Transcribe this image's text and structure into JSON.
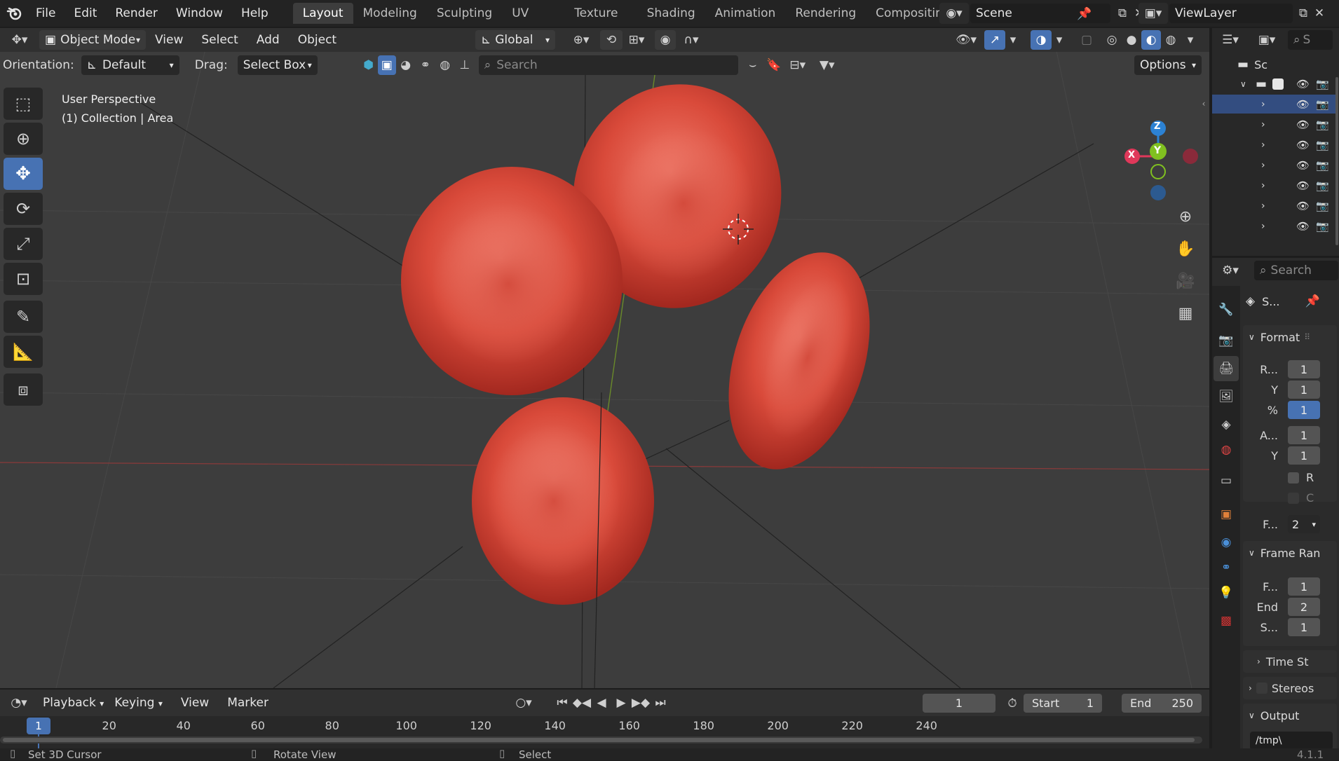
{
  "app": {
    "version": "4.1.1"
  },
  "menu": [
    "File",
    "Edit",
    "Render",
    "Window",
    "Help"
  ],
  "workspaces": [
    "Layout",
    "Modeling",
    "Sculpting",
    "UV Editing",
    "Texture Paint",
    "Shading",
    "Animation",
    "Rendering",
    "Compositing"
  ],
  "scene": {
    "name": "Scene",
    "view_layer": "ViewLayer"
  },
  "viewport_header": {
    "mode": "Object Mode",
    "menus": [
      "View",
      "Select",
      "Add",
      "Object"
    ],
    "transform_orientation": "Global"
  },
  "tool_settings": {
    "orientation_label": "Orientation:",
    "orientation_value": "Default",
    "drag_label": "Drag:",
    "drag_value": "Select Box",
    "search_placeholder": "Search",
    "options_label": "Options"
  },
  "viewport_overlay": {
    "view_name": "User Perspective",
    "collection_info": "(1) Collection | Area"
  },
  "gizmo": {
    "x_label": "X",
    "y_label": "Y",
    "z_label": "Z",
    "x_color": "#e0385a",
    "y_color": "#80c020",
    "z_color": "#2c82d4"
  },
  "outliner": {
    "scene_label": "Sc",
    "search_label": "S",
    "row_count": 8
  },
  "properties": {
    "search_placeholder": "Search",
    "scene_tab_label": "S...",
    "format_panel": {
      "title": "Format",
      "res_x_label": "R...",
      "res_x_value": "1",
      "res_y_label": "Y",
      "res_y_value": "1",
      "pct_label": "%",
      "pct_value": "1",
      "aspect_x_label": "A...",
      "aspect_x_value": "1",
      "aspect_y_label": "Y",
      "aspect_y_value": "1",
      "render_region_label": "R",
      "crop_label": "C",
      "fps_label": "F...",
      "fps_value": "2"
    },
    "frame_range_panel": {
      "title": "Frame Ran",
      "start_label": "F...",
      "start_value": "1",
      "end_label": "End",
      "end_value": "2",
      "step_label": "S...",
      "step_value": "1"
    },
    "time_stretching": "Time St",
    "stereoscopy": "Stereos",
    "output_panel": {
      "title": "Output",
      "path": "/tmp\\"
    }
  },
  "timeline": {
    "menus": [
      "Playback",
      "Keying",
      "View",
      "Marker"
    ],
    "current_frame": "1",
    "start_label": "Start",
    "start_value": "1",
    "end_label": "End",
    "end_value": "250",
    "ticks": [
      "20",
      "40",
      "60",
      "80",
      "100",
      "120",
      "140",
      "160",
      "180",
      "200",
      "220",
      "240"
    ],
    "playhead": "1"
  },
  "statusbar": {
    "set_cursor": "Set 3D Cursor",
    "rotate_view": "Rotate View",
    "select": "Select"
  },
  "colors": {
    "accent": "#4772b3",
    "cell": "#e05040"
  }
}
